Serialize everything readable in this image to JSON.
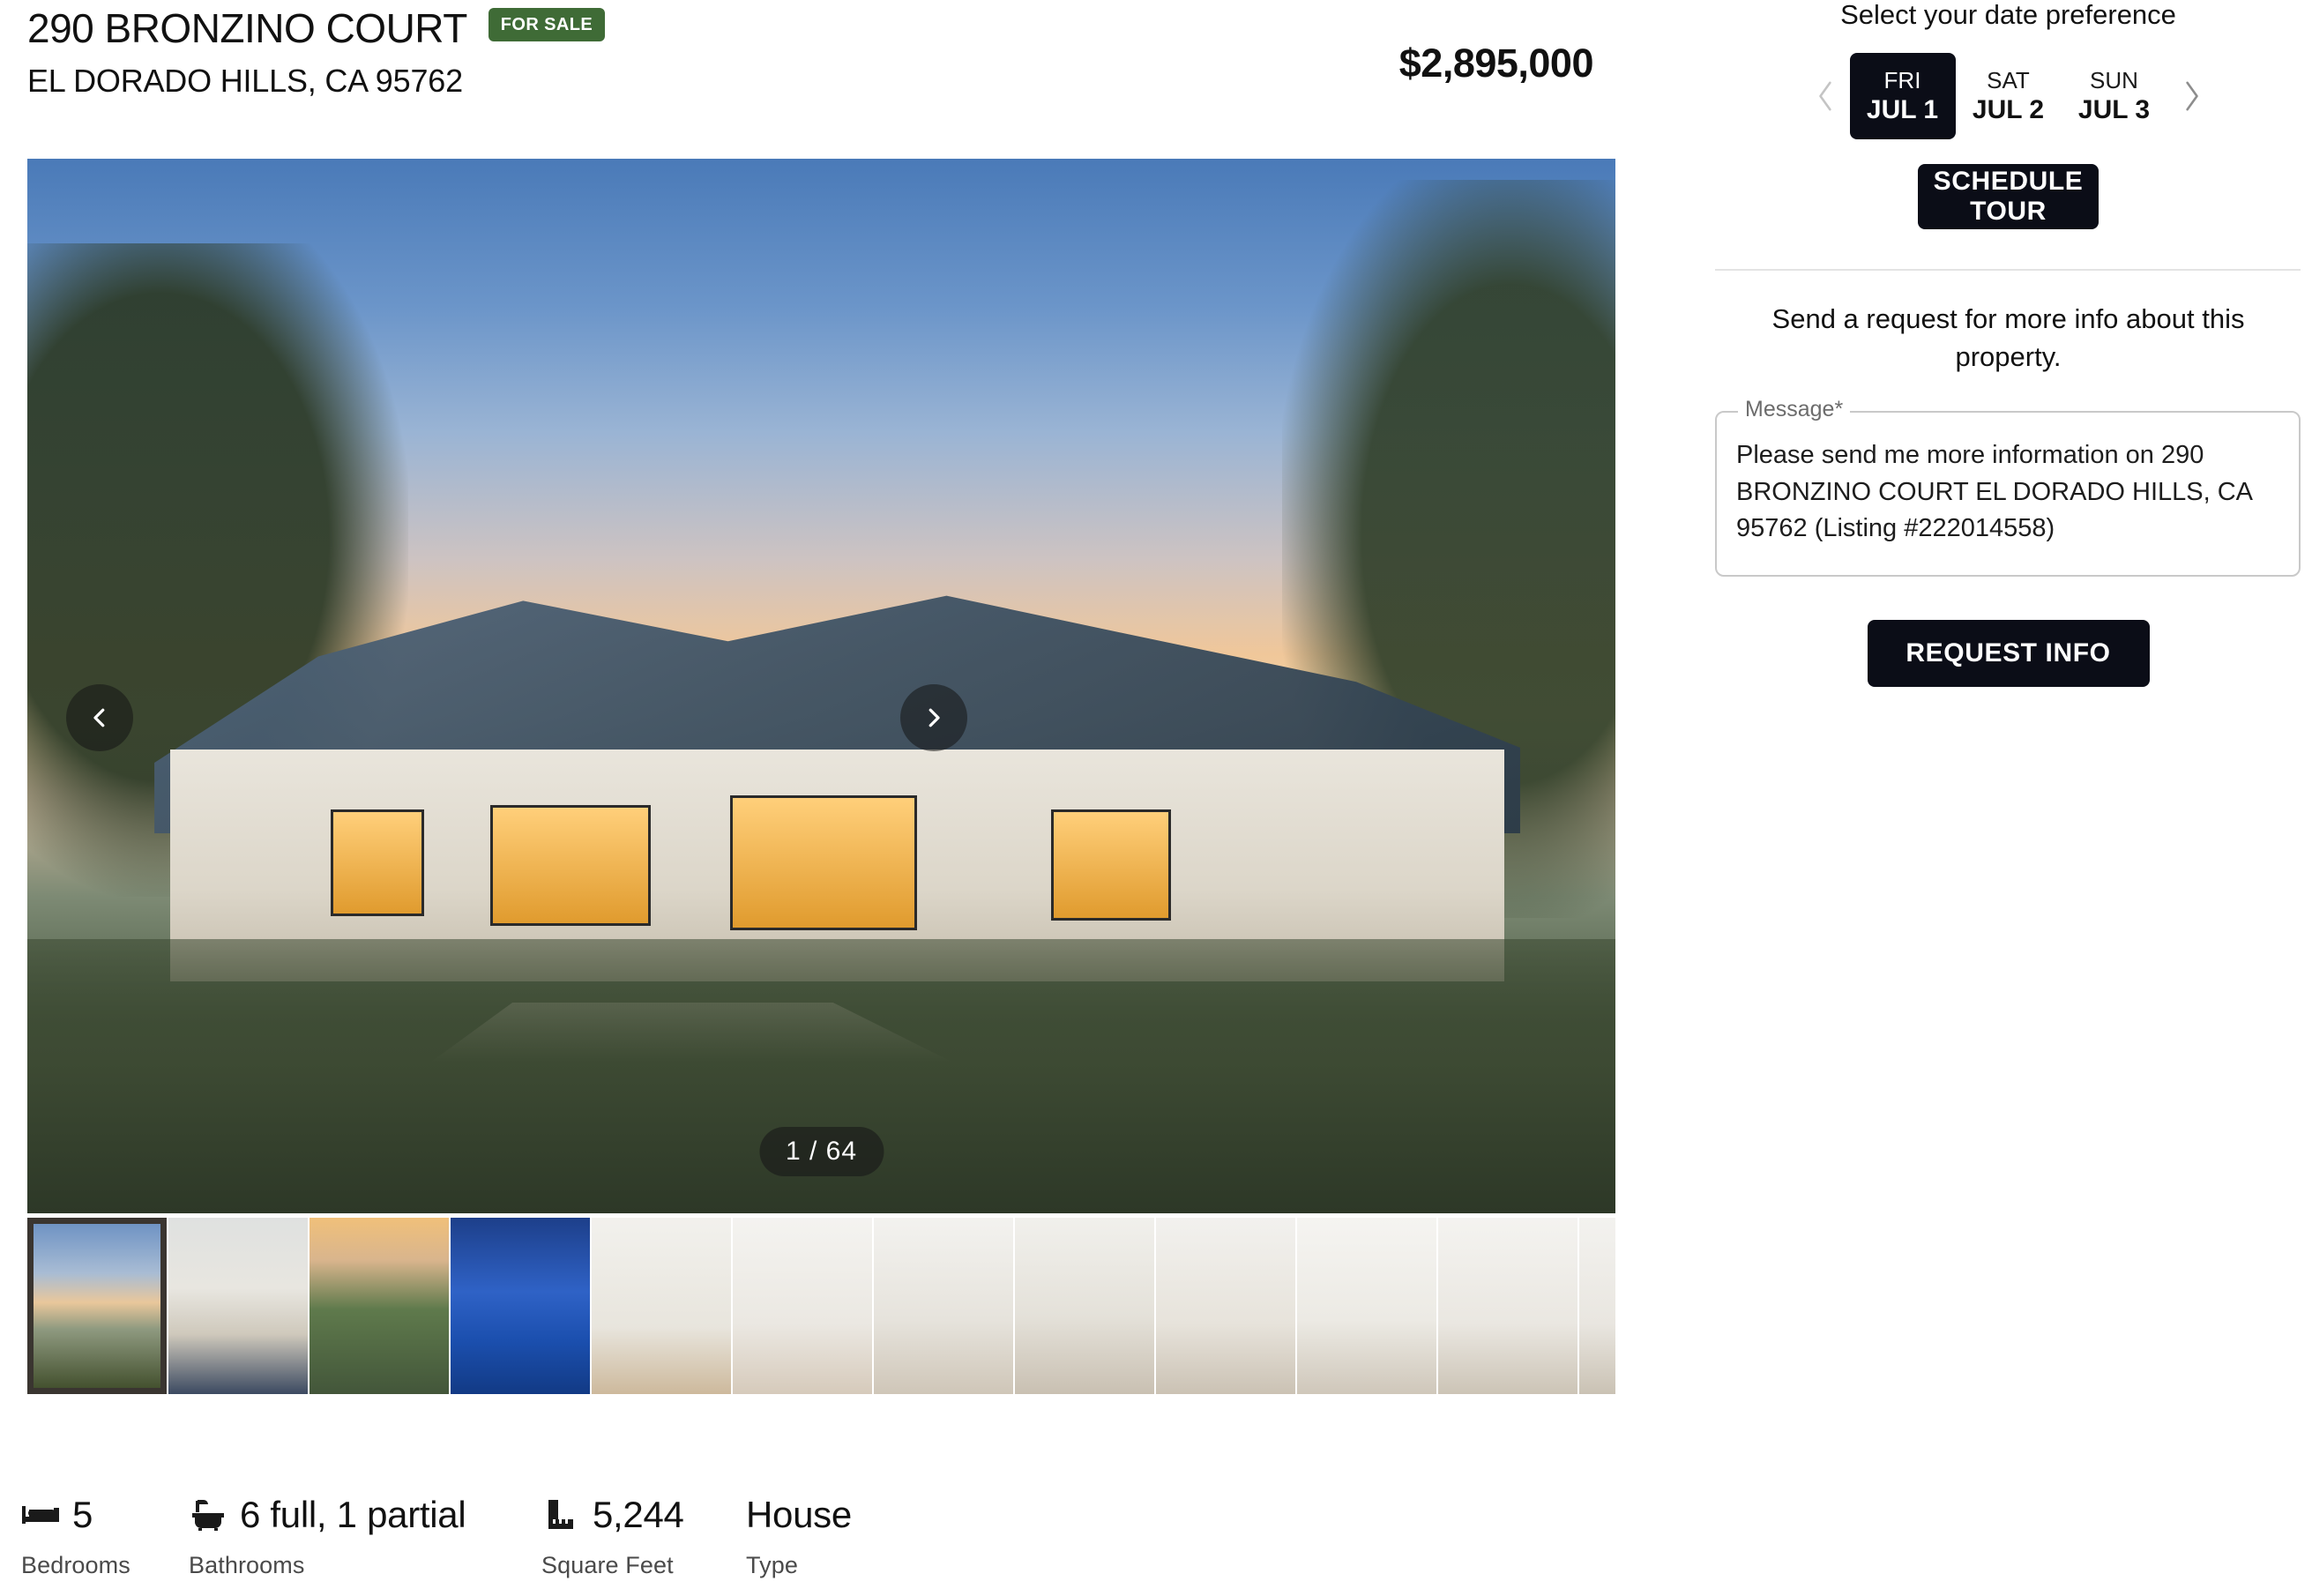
{
  "listing": {
    "street_address": "290 BRONZINO COURT",
    "city_state_zip": "EL DORADO HILLS, CA 95762",
    "status_badge": "FOR SALE",
    "price": "$2,895,000",
    "listing_id": "222014558"
  },
  "gallery": {
    "counter": "1 / 64",
    "current_index": 1,
    "total_images": 64,
    "prev_icon": "chevron-left-icon",
    "next_icon": "chevron-right-icon",
    "thumbnails": [
      {
        "name": "exterior-dusk-front",
        "style": "tg-dusk",
        "active": true
      },
      {
        "name": "covered-patio",
        "style": "tg-patio",
        "active": false
      },
      {
        "name": "aerial-sunset-view",
        "style": "tg-aerial",
        "active": false
      },
      {
        "name": "pool-at-night",
        "style": "tg-pool",
        "active": false
      },
      {
        "name": "interior-entry",
        "style": "tg-int1",
        "active": false
      },
      {
        "name": "interior-hallway",
        "style": "tg-int2",
        "active": false
      },
      {
        "name": "living-room",
        "style": "tg-living",
        "active": false
      },
      {
        "name": "great-room",
        "style": "tg-great",
        "active": false
      },
      {
        "name": "fireplace-room",
        "style": "tg-fire",
        "active": false
      },
      {
        "name": "kitchen-island",
        "style": "tg-kitch1",
        "active": false
      },
      {
        "name": "kitchen-sink",
        "style": "tg-kitch2",
        "active": false
      },
      {
        "name": "kitchen-wide",
        "style": "tg-kitch3",
        "active": false
      }
    ]
  },
  "stats": [
    {
      "icon": "bed-icon",
      "value": "5",
      "label": "Bedrooms"
    },
    {
      "icon": "bath-icon",
      "value": "6 full, 1 partial",
      "label": "Bathrooms"
    },
    {
      "icon": "ruler-icon",
      "value": "5,244",
      "label": "Square Feet"
    },
    {
      "icon": "none",
      "value": "House",
      "label": "Type"
    }
  ],
  "sidebar": {
    "date_pref_title": "Select your date preference",
    "dates": [
      {
        "dow": "FRI",
        "day": "JUL 1",
        "selected": true
      },
      {
        "dow": "SAT",
        "day": "JUL 2",
        "selected": false
      },
      {
        "dow": "SUN",
        "day": "JUL 3",
        "selected": false
      }
    ],
    "prev_date_icon": "chevron-left-icon",
    "next_date_icon": "chevron-right-icon",
    "schedule_tour_label": "SCHEDULE TOUR",
    "request_heading": "Send a request for more info about this property.",
    "message_legend": "Message*",
    "message_value": "Please send me more information on 290 BRONZINO COURT EL DORADO HILLS, CA 95762 (Listing #222014558)",
    "request_info_label": "REQUEST INFO"
  },
  "colors": {
    "badge_green": "#3f6b36",
    "dark_button": "#0b0d17",
    "text_primary": "#111111",
    "divider": "#e3e3e3"
  }
}
